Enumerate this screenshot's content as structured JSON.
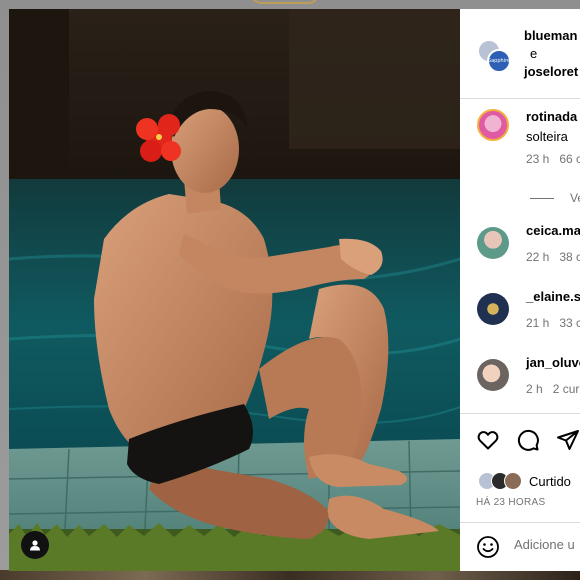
{
  "post": {
    "header": {
      "user1": "blueman",
      "conjunction": "e",
      "user2": "joseloret",
      "badge_text": "Sapphire"
    },
    "comments": [
      {
        "user": "rotinada",
        "text": "solteira",
        "time": "23 h",
        "likes": "66 c"
      },
      {
        "user": "ceica.ma",
        "time": "22 h",
        "likes": "38 c"
      },
      {
        "user": "_elaine.s",
        "time": "21 h",
        "likes": "33 c"
      },
      {
        "user": "jan_oluve",
        "time": "2 h",
        "likes": "2 cur"
      }
    ],
    "view_replies": "Ve",
    "liked_by": "Curtido",
    "time_ago": "HÁ 23 HORAS",
    "add_comment_placeholder": "Adicione u"
  },
  "icons": {
    "like": "heart-icon",
    "comment": "comment-icon",
    "share": "share-icon",
    "emoji": "emoji-icon",
    "user_tag": "user-tag-icon"
  },
  "colors": {
    "accent_flower": "#e2251b",
    "pool_water": "#0f5a60",
    "muted_text": "#737373",
    "divider": "#dbdbdb"
  }
}
